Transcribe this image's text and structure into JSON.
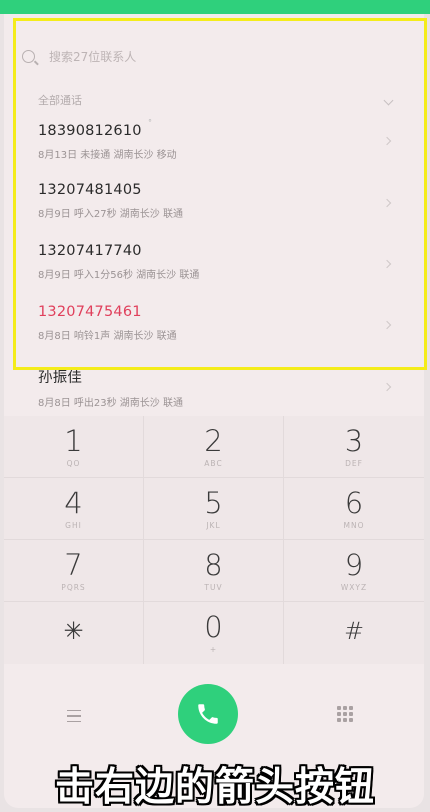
{
  "search": {
    "placeholder": "搜索27位联系人"
  },
  "filter": {
    "label": "全部通话"
  },
  "calls": [
    {
      "number": "18390812610",
      "meta": "8月13日 未接通 湖南长沙 移动",
      "missed": false
    },
    {
      "number": "13207481405",
      "meta": "8月9日 呼入27秒 湖南长沙 联通",
      "missed": false
    },
    {
      "number": "13207417740",
      "meta": "8月9日 呼入1分56秒 湖南长沙 联通",
      "missed": false
    },
    {
      "number": "13207475461",
      "meta": "8月8日 响铃1声 湖南长沙 联通",
      "missed": true
    },
    {
      "number": "孙振佳",
      "meta": "8月8日 呼出23秒 湖南长沙 联通",
      "missed": false
    }
  ],
  "keypad": [
    {
      "digit": "1",
      "letters": "QO"
    },
    {
      "digit": "2",
      "letters": "ABC"
    },
    {
      "digit": "3",
      "letters": "DEF"
    },
    {
      "digit": "4",
      "letters": "GHI"
    },
    {
      "digit": "5",
      "letters": "JKL"
    },
    {
      "digit": "6",
      "letters": "MNO"
    },
    {
      "digit": "7",
      "letters": "PQRS"
    },
    {
      "digit": "8",
      "letters": "TUV"
    },
    {
      "digit": "9",
      "letters": "WXYZ"
    },
    {
      "digit": "✳",
      "letters": ""
    },
    {
      "digit": "0",
      "letters": "+"
    },
    {
      "digit": "#",
      "letters": ""
    }
  ],
  "caption": "击右边的箭头按钮",
  "colors": {
    "accent": "#2fd07c",
    "missed": "#e0405c",
    "highlight": "#f4ec1a"
  }
}
